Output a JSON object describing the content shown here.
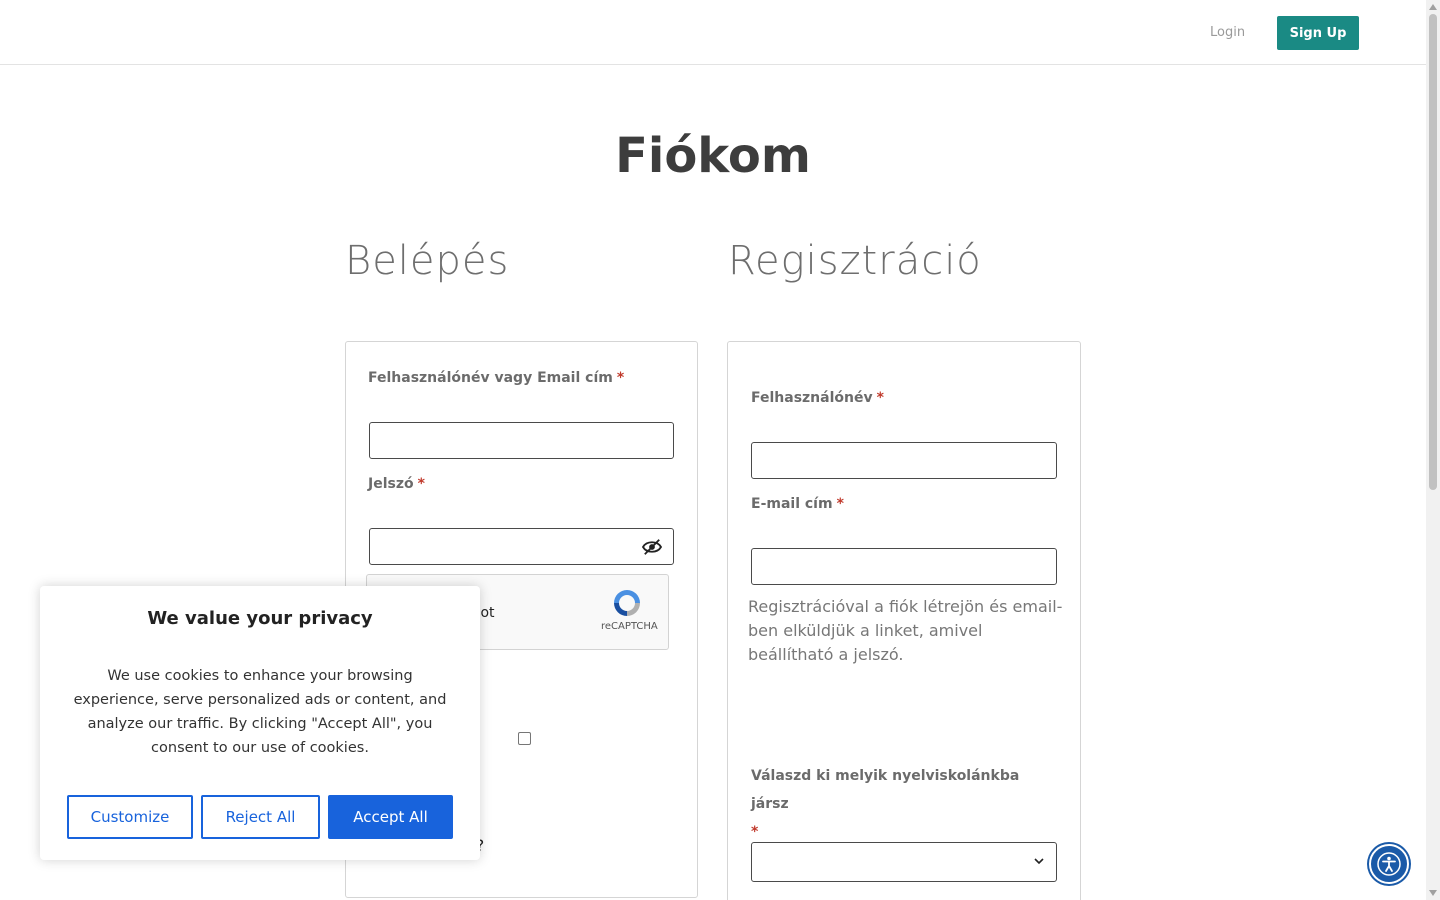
{
  "header": {
    "login_label": "Login",
    "signup_label": "Sign Up"
  },
  "page_title": "Fiókom",
  "login": {
    "section_title": "Belépés",
    "username_label": "Felhasználónév vagy Email cím",
    "password_label": "Jelszó",
    "captcha_text": "obot",
    "captcha_brand": "reCAPTCHA",
    "lost_password_partial": "ó?"
  },
  "register": {
    "section_title": "Regisztráció",
    "username_label": "Felhasználónév",
    "email_label": "E-mail cím",
    "note": "Regisztrációval a fiók létrejön és email-ben elküldjük a linket, amivel beállítható a jelszó.",
    "school_label": "Válaszd ki melyik nyelviskolánkba jársz"
  },
  "required_mark": "*",
  "cookie": {
    "title": "We value your privacy",
    "text": "We use cookies to enhance your browsing experience, serve personalized ads or content, and analyze our traffic. By clicking \"Accept All\", you consent to our use of cookies.",
    "customize_label": "Customize",
    "reject_label": "Reject All",
    "accept_label": "Accept All"
  },
  "icons": {
    "password_toggle": "eye-slash-icon",
    "captcha": "recaptcha-icon",
    "accessibility": "accessibility-icon",
    "select": "chevron-down-icon"
  },
  "colors": {
    "brand": "#1a8a84",
    "cookie_accent": "#1863dc",
    "required": "#c0392b"
  }
}
